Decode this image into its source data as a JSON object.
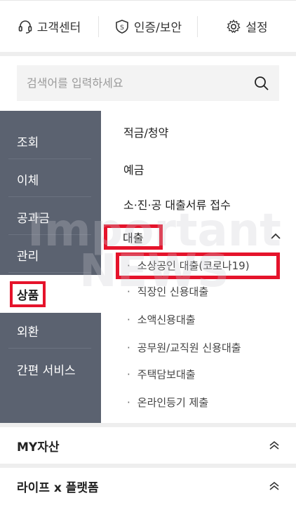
{
  "top_nav": {
    "customer_center": "고객센터",
    "auth_security": "인증/보안",
    "settings": "설정"
  },
  "search": {
    "placeholder": "검색어를 입력하세요"
  },
  "left_menu": {
    "items": [
      {
        "label": "조회"
      },
      {
        "label": "이체"
      },
      {
        "label": "공과금"
      },
      {
        "label": "관리"
      },
      {
        "label": "상품",
        "active": true
      },
      {
        "label": "외환"
      },
      {
        "label": "간편 서비스"
      }
    ]
  },
  "right_menu": {
    "items": [
      {
        "label": "적금/청약"
      },
      {
        "label": "예금"
      },
      {
        "label": "소·진·공 대출서류 접수"
      }
    ],
    "category": {
      "label": "대출",
      "expanded": true,
      "sub_items": [
        {
          "label": "소상공인 대출(코로나19)",
          "highlighted": true
        },
        {
          "label": "직장인 신용대출"
        },
        {
          "label": "소액신용대출"
        },
        {
          "label": "공무원/교직원 신용대출"
        },
        {
          "label": "주택담보대출"
        },
        {
          "label": "온라인등기 제출"
        }
      ]
    }
  },
  "accordions": [
    {
      "label": "MY자산"
    },
    {
      "label": "라이프 x 플랫폼"
    }
  ],
  "watermark": {
    "line1": "Important",
    "line2": "NEWS"
  },
  "colors": {
    "sidebar": "#5b6270",
    "highlight": "#e5132b"
  }
}
